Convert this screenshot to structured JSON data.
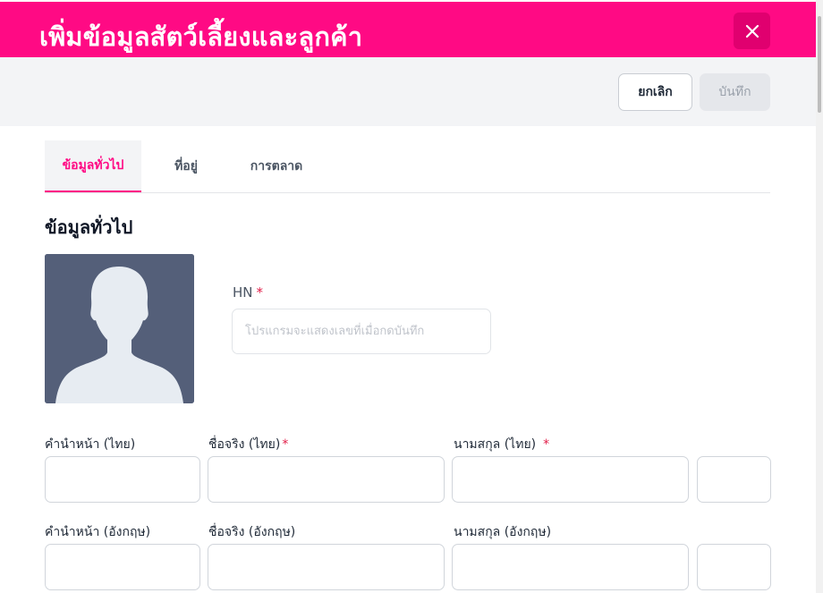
{
  "header": {
    "title": "เพิ่มข้อมูลสัตว์เลี้ยงและลูกค้า",
    "close_icon": "close-icon",
    "color": "#ff0a84"
  },
  "actions": {
    "cancel_label": "ยกเลิก",
    "save_label": "บันทึก"
  },
  "tabs": [
    {
      "label": "ข้อมูลทั่วไป",
      "active": true
    },
    {
      "label": "ที่อยู่",
      "active": false
    },
    {
      "label": "การตลาด",
      "active": false
    }
  ],
  "section": {
    "title": "ข้อมูลทั่วไป"
  },
  "avatar": {
    "icon": "person-silhouette-icon"
  },
  "fields": {
    "hn": {
      "label": "HN",
      "required_mark": "*",
      "placeholder": "โปรแกรมจะแสดงเลขที่เมื่อกดบันทึก",
      "value": ""
    },
    "prefix_th": {
      "label": "คำนำหน้า (ไทย)",
      "value": ""
    },
    "firstname_th": {
      "label": "ชื่อจริง (ไทย)",
      "required_mark": "*",
      "value": ""
    },
    "lastname_th": {
      "label": "นามสกุล (ไทย)",
      "required_mark": "*",
      "value": ""
    },
    "extra_th": {
      "value": ""
    },
    "prefix_en": {
      "label": "คำนำหน้า (อังกฤษ)",
      "value": ""
    },
    "firstname_en": {
      "label": "ชื่อจริง (อังกฤษ)",
      "value": ""
    },
    "lastname_en": {
      "label": "นามสกุล (อังกฤษ)",
      "value": ""
    },
    "extra_en": {
      "value": ""
    }
  }
}
